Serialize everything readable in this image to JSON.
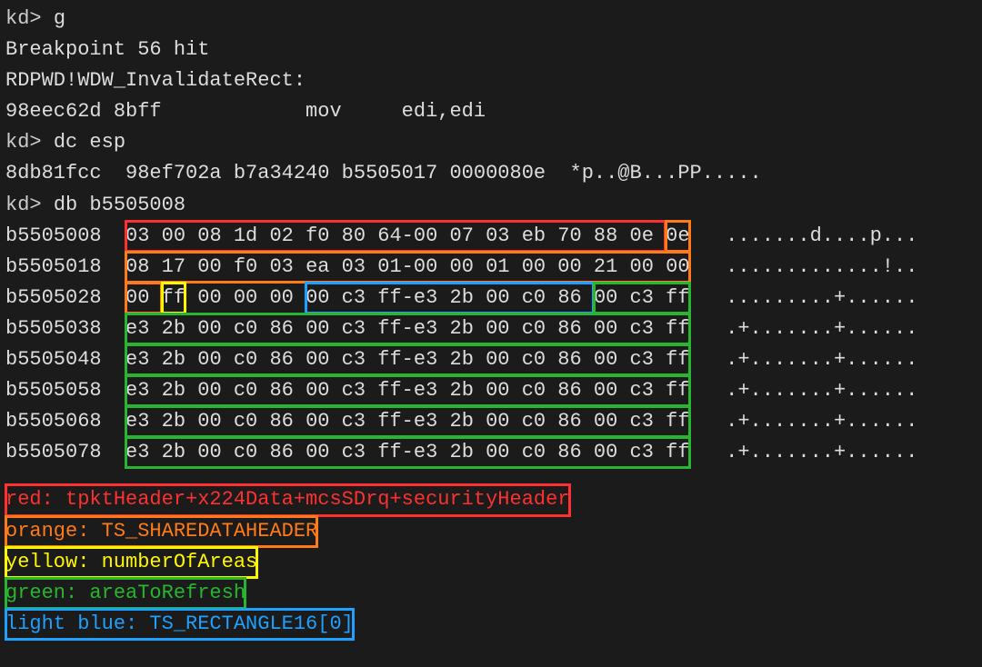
{
  "commands": {
    "c1_prompt": "kd> ",
    "c1_cmd": "g",
    "bp": "Breakpoint 56 hit",
    "sym": "RDPWD!WDW_InvalidateRect:",
    "dis": "98eec62d 8bff            mov     edi,edi",
    "c2_prompt": "kd> ",
    "c2_cmd": "dc esp",
    "dc_line": "8db81fcc  98ef702a b7a34240 b5505017 0000080e  *p..@B...PP.....",
    "c3_prompt": "kd> ",
    "c3_cmd": "db b5505008"
  },
  "hex": {
    "r1_addr": "b5505008  ",
    "r1_red": "03 00 08 1d 02 f0 80 64-00 07 03 eb 70 88 0e ",
    "r1_orange": "0e",
    "r1_ascii": "   .......d....p...",
    "r2_addr": "b5505018  ",
    "r2_orange": "08 17 00 f0 03 ea 03 01-00 00 01 00 00 21 00 00",
    "r2_ascii": "   .............!..",
    "r3_addr": "b5505028  ",
    "r3_orange": "00 ",
    "r3_yellow": "ff",
    "r3_gap1": " 00 00 00 ",
    "r3_blue": "00 c3 ff-e3 2b 00 c0 86 ",
    "r3_green_tail": "00 c3 ff",
    "r3_ascii": "   .........+......",
    "r4_addr": "b5505038  ",
    "r4_green": "e3 2b 00 c0 86 00 c3 ff-e3 2b 00 c0 86 00 c3 ff",
    "r4_ascii": "   .+.......+......",
    "r5_addr": "b5505048  ",
    "r5_green": "e3 2b 00 c0 86 00 c3 ff-e3 2b 00 c0 86 00 c3 ff",
    "r5_ascii": "   .+.......+......",
    "r6_addr": "b5505058  ",
    "r6_green": "e3 2b 00 c0 86 00 c3 ff-e3 2b 00 c0 86 00 c3 ff",
    "r6_ascii": "   .+.......+......",
    "r7_addr": "b5505068  ",
    "r7_green": "e3 2b 00 c0 86 00 c3 ff-e3 2b 00 c0 86 00 c3 ff",
    "r7_ascii": "   .+.......+......",
    "r8_addr": "b5505078  ",
    "r8_green": "e3 2b 00 c0 86 00 c3 ff-e3 2b 00 c0 86 00 c3 ff",
    "r8_ascii": "   .+.......+......"
  },
  "legend": {
    "red": "red: tpktHeader+x224Data+mcsSDrq+securityHeader",
    "orange": "orange: TS_SHAREDATAHEADER",
    "yellow": "yellow: numberOfAreas",
    "green": "green: areaToRefresh",
    "blue": "light blue: TS_RECTANGLE16[0]"
  },
  "colors": {
    "red": "#ff3030",
    "orange": "#ff7b18",
    "yellow": "#fff700",
    "green": "#28b52f",
    "blue": "#1ea0ff",
    "bg": "#1b1b1b",
    "fg": "#dddddd"
  }
}
